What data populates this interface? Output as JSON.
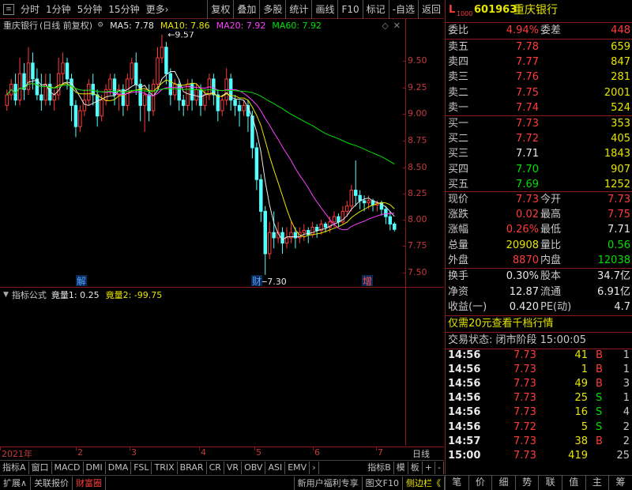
{
  "toolbar": {
    "items": [
      "分时",
      "1分钟",
      "5分钟",
      "15分钟",
      "更多›"
    ],
    "items2": [
      "复权",
      "叠加",
      "多股",
      "统计",
      "画线",
      "F10",
      "标记",
      "-自选",
      "返回"
    ]
  },
  "chart": {
    "stock_name": "重庆银行",
    "mode": "(日线 前复权)",
    "ma5": "MA5: 7.78",
    "ma10": "MA10: 7.86",
    "ma20": "MA20: 7.92",
    "ma60": "MA60: 7.92",
    "ma5_color": "#e8e8e8",
    "ma10_color": "#e6e600",
    "ma20_color": "#ff40ff",
    "ma60_color": "#00e000",
    "high_label": "9.57",
    "low_label": "7.30",
    "markers": [
      "解",
      "财",
      "增"
    ]
  },
  "chart_data": {
    "type": "line",
    "yticks": [
      "9.50",
      "9.25",
      "9.00",
      "8.75",
      "8.50",
      "8.25",
      "8.00",
      "7.75",
      "7.50"
    ],
    "ylim": [
      7.3,
      9.57
    ],
    "xticks": [
      "2021年",
      "2",
      "3",
      "4",
      "5",
      "6",
      "7"
    ],
    "axis_label_right": "日线"
  },
  "indicator": {
    "title": "指标公式",
    "v1": "竟量1: 0.25",
    "v2": "竟量2: -99.75"
  },
  "tabs": [
    "指标A",
    "窗口",
    "MACD",
    "DMI",
    "DMA",
    "FSL",
    "TRIX",
    "BRAR",
    "CR",
    "VR",
    "OBV",
    "ASI",
    "EMV",
    "›",
    "指标B",
    "模",
    "板",
    "+",
    "-"
  ],
  "bottom": {
    "left": [
      "扩展∧",
      "关联报价",
      "财富圈"
    ],
    "mid": "新用户福利专享",
    "right": [
      "图文F10",
      "侧边栏《"
    ],
    "nav": [
      "笔",
      "价",
      "细",
      "势",
      "联",
      "值",
      "主",
      "筹"
    ]
  },
  "quote": {
    "prefix": "L",
    "level": "1000",
    "code": "601963",
    "name": "重庆银行",
    "weibi_l": "委比",
    "weibi": "4.94%",
    "weicha_l": "委差",
    "weicha": "448",
    "sell": [
      {
        "l": "卖五",
        "p": "7.78",
        "v": "659"
      },
      {
        "l": "卖四",
        "p": "7.77",
        "v": "847"
      },
      {
        "l": "卖三",
        "p": "7.76",
        "v": "281"
      },
      {
        "l": "卖二",
        "p": "7.75",
        "v": "2001"
      },
      {
        "l": "卖一",
        "p": "7.74",
        "v": "524"
      }
    ],
    "buy": [
      {
        "l": "买一",
        "p": "7.73",
        "v": "353"
      },
      {
        "l": "买二",
        "p": "7.72",
        "v": "405"
      },
      {
        "l": "买三",
        "p": "7.71",
        "v": "1843"
      },
      {
        "l": "买四",
        "p": "7.70",
        "v": "907"
      },
      {
        "l": "买五",
        "p": "7.69",
        "v": "1252"
      }
    ],
    "stats": [
      {
        "l1": "现价",
        "v1": "7.73",
        "l2": "今开",
        "v2": "7.73"
      },
      {
        "l1": "涨跌",
        "v1": "0.02",
        "l2": "最高",
        "v2": "7.75"
      },
      {
        "l1": "涨幅",
        "v1": "0.26%",
        "l2": "最低",
        "v2": "7.71"
      },
      {
        "l1": "总量",
        "v1": "20908",
        "l2": "量比",
        "v2": "0.56"
      },
      {
        "l1": "外盘",
        "v1": "8870",
        "l2": "内盘",
        "v2": "12038"
      }
    ],
    "stats2": [
      {
        "l1": "换手",
        "v1": "0.30%",
        "l2": "股本",
        "v2": "34.7亿"
      },
      {
        "l1": "净资",
        "v1": "12.87",
        "l2": "流通",
        "v2": "6.91亿"
      },
      {
        "l1": "收益(一)",
        "v1": "0.420",
        "l2": "PE(动)",
        "v2": "4.7"
      }
    ],
    "promo": "仅需20元查看千档行情",
    "status": "交易状态: 闭市阶段 15:00:05",
    "ticks": [
      {
        "t": "14:56",
        "p": "7.73",
        "v": "41",
        "d": "B",
        "n": "1"
      },
      {
        "t": "14:56",
        "p": "7.73",
        "v": "1",
        "d": "B",
        "n": "1"
      },
      {
        "t": "14:56",
        "p": "7.73",
        "v": "49",
        "d": "B",
        "n": "3"
      },
      {
        "t": "14:56",
        "p": "7.73",
        "v": "25",
        "d": "S",
        "n": "1"
      },
      {
        "t": "14:56",
        "p": "7.73",
        "v": "16",
        "d": "S",
        "n": "4"
      },
      {
        "t": "14:56",
        "p": "7.72",
        "v": "5",
        "d": "S",
        "n": "2"
      },
      {
        "t": "14:57",
        "p": "7.73",
        "v": "38",
        "d": "B",
        "n": "2"
      },
      {
        "t": "15:00",
        "p": "7.73",
        "v": "419",
        "d": "",
        "n": "25"
      }
    ]
  }
}
